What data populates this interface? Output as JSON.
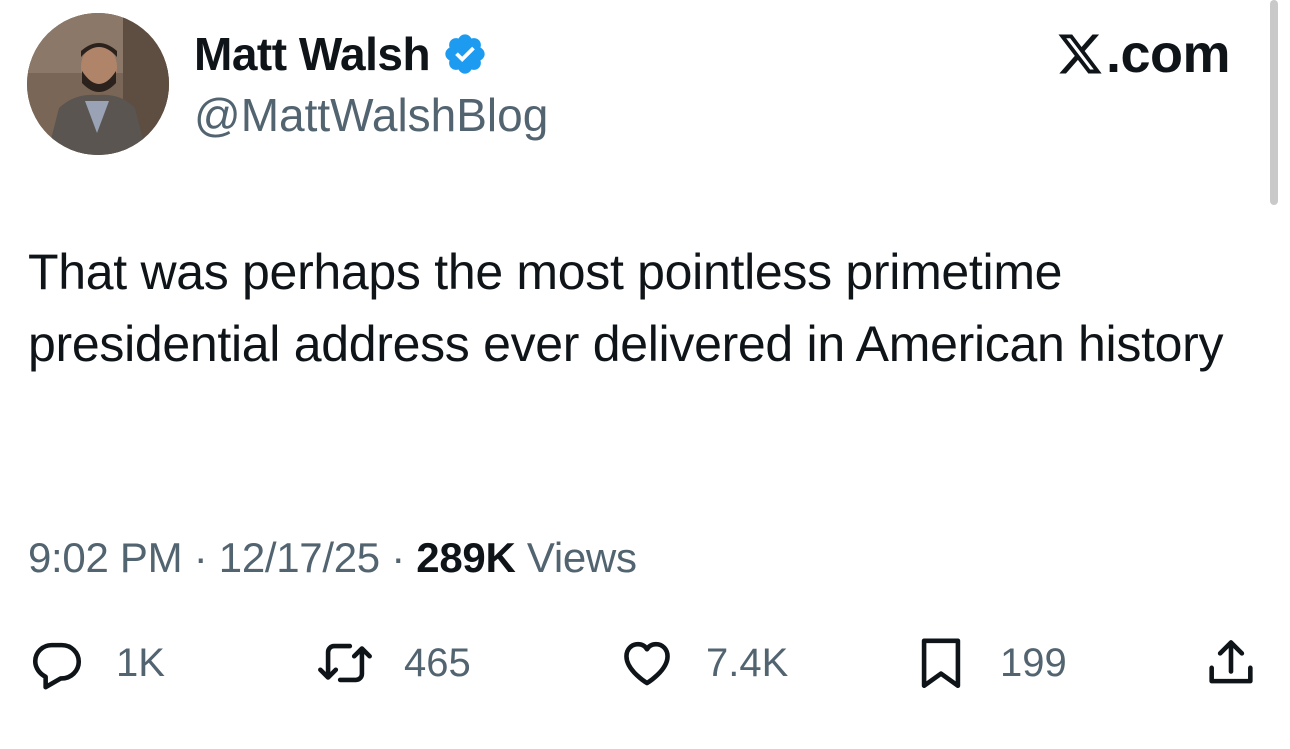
{
  "author": {
    "name": "Matt Walsh",
    "handle": "@MattWalshBlog",
    "verified": true,
    "verified_color": "#1d9bf0"
  },
  "site": {
    "label": ".com",
    "logo_icon": "x-logo-icon"
  },
  "tweet": {
    "text": "That was perhaps the most pointless primetime presidential address ever delivered in American history"
  },
  "meta": {
    "time": "9:02 PM",
    "separator": "·",
    "date": "12/17/25",
    "views_count": "289K",
    "views_label": "Views"
  },
  "actions": {
    "reply": {
      "icon": "reply-icon",
      "count": "1K"
    },
    "repost": {
      "icon": "repost-icon",
      "count": "465"
    },
    "like": {
      "icon": "heart-icon",
      "count": "7.4K"
    },
    "bookmark": {
      "icon": "bookmark-icon",
      "count": "199"
    },
    "share": {
      "icon": "share-icon"
    }
  },
  "colors": {
    "text": "#0f1419",
    "secondary": "#536471"
  }
}
